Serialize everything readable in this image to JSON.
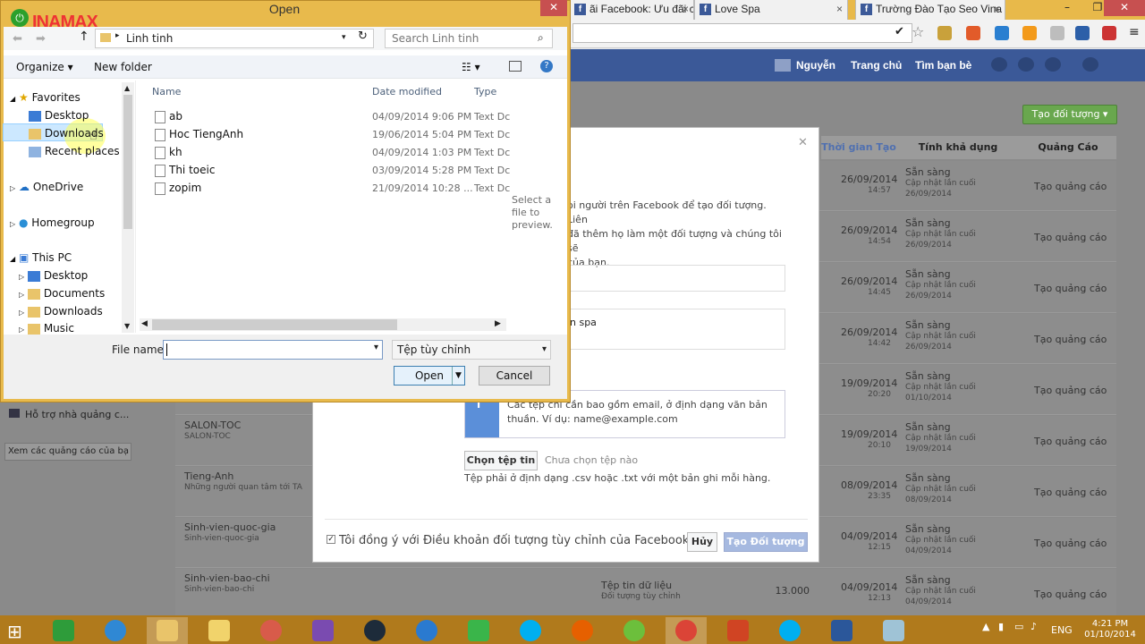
{
  "browser": {
    "tabs": [
      {
        "label": "ãi Facebook: Ưu đãi c",
        "icon": "facebook-icon"
      },
      {
        "label": "Love Spa",
        "icon": "facebook-icon"
      },
      {
        "label": "Trường Đào Tạo Seo Vina",
        "icon": "facebook-icon"
      }
    ]
  },
  "fb": {
    "nav": {
      "user": "Nguyễn",
      "home": "Trang chủ",
      "find_friends": "Tìm bạn bè"
    },
    "create_audience_button": "Tạo đối tượng",
    "table": {
      "headers": [
        "Thời gian Tạo",
        "Tính khả dụng",
        "Quảng Cáo"
      ],
      "rows": [
        {
          "name": "",
          "sub": "",
          "source": "",
          "size": "",
          "date": "26/09/2014",
          "time": "14:57",
          "status": "Sẵn sàng",
          "status_sub": "Cập nhật lần cuối",
          "status_date": "26/09/2014",
          "action": "Tạo quảng cáo"
        },
        {
          "name": "",
          "sub": "",
          "source": "",
          "size": "",
          "date": "26/09/2014",
          "time": "14:54",
          "status": "Sẵn sàng",
          "status_sub": "Cập nhật lần cuối",
          "status_date": "26/09/2014",
          "action": "Tạo quảng cáo"
        },
        {
          "name": "",
          "sub": "",
          "source": "",
          "size": "",
          "date": "26/09/2014",
          "time": "14:45",
          "status": "Sẵn sàng",
          "status_sub": "Cập nhật lần cuối",
          "status_date": "26/09/2014",
          "action": "Tạo quảng cáo"
        },
        {
          "name": "",
          "sub": "",
          "source": "",
          "size": "",
          "date": "26/09/2014",
          "time": "14:42",
          "status": "Sẵn sàng",
          "status_sub": "Cập nhật lần cuối",
          "status_date": "26/09/2014",
          "action": "Tạo quảng cáo"
        },
        {
          "name": "",
          "sub": "",
          "source": "",
          "size": "",
          "date": "19/09/2014",
          "time": "20:20",
          "status": "Sẵn sàng",
          "status_sub": "Cập nhật lần cuối",
          "status_date": "01/10/2014",
          "action": "Tạo quảng cáo"
        },
        {
          "name": "SALON-TOC",
          "sub": "SALON-TOC",
          "source": "",
          "size": "",
          "date": "19/09/2014",
          "time": "20:10",
          "status": "Sẵn sàng",
          "status_sub": "Cập nhật lần cuối",
          "status_date": "19/09/2014",
          "action": "Tạo quảng cáo"
        },
        {
          "name": "Tieng-Anh",
          "sub": "Những người quan tâm tới TA",
          "source": "",
          "size": "",
          "date": "08/09/2014",
          "time": "23:35",
          "status": "Sẵn sàng",
          "status_sub": "Cập nhật lần cuối",
          "status_date": "08/09/2014",
          "action": "Tạo quảng cáo"
        },
        {
          "name": "Sinh-vien-quoc-gia",
          "sub": "Sinh-vien-quoc-gia",
          "source": "",
          "size": "",
          "date": "04/09/2014",
          "time": "12:15",
          "status": "Sẵn sàng",
          "status_sub": "Cập nhật lần cuối",
          "status_date": "04/09/2014",
          "action": "Tạo quảng cáo"
        },
        {
          "name": "Sinh-vien-bao-chi",
          "sub": "Sinh-vien-bao-chi",
          "source": "Tệp tin dữ liệu",
          "source_sub": "Đối tượng tùy chỉnh",
          "size": "13.000",
          "date": "04/09/2014",
          "time": "12:13",
          "status": "Sẵn sàng",
          "status_sub": "Cập nhật lần cuối",
          "status_date": "04/09/2014",
          "action": "Tạo quảng cáo"
        }
      ]
    },
    "left": {
      "support_link": "Hỗ trợ nhà quảng c...",
      "view_ads": "Xem các quảng cáo của bạ"
    },
    "modal": {
      "intro_line1": "ọi người trên Facebook để tạo đối tượng. Liên",
      "intro_line2": "đã thêm họ làm một đối tượng và chúng tôi sẽ",
      "intro_line3": "của bạn.",
      "name_value": "n spa",
      "info_line1": "Các tệp chỉ cần bao gồm email, ở định dạng văn bản",
      "info_line2": "thuần. Ví dụ: name@example.com",
      "choose_file": "Chọn tệp tin",
      "no_file": "Chưa chọn tệp nào",
      "file_hint": "Tệp phải ở định dạng .csv hoặc .txt với một bản ghi mỗi hàng.",
      "agree": "Tôi đồng ý với Điều khoản đối tượng tùy chỉnh của Facebook",
      "cancel": "Hủy",
      "create": "Tạo Đối tượng"
    }
  },
  "dialog": {
    "title": "Open",
    "path": "Linh tinh",
    "search_placeholder": "Search Linh tinh",
    "organize": "Organize",
    "new_folder": "New folder",
    "nav": {
      "favorites": "Favorites",
      "desktop": "Desktop",
      "downloads": "Downloads",
      "recent": "Recent places",
      "onedrive": "OneDrive",
      "homegroup": "Homegroup",
      "thispc": "This PC",
      "pc_desktop": "Desktop",
      "pc_documents": "Documents",
      "pc_downloads": "Downloads",
      "pc_music": "Music"
    },
    "columns": {
      "name": "Name",
      "date": "Date modified",
      "type": "Type"
    },
    "files": [
      {
        "name": "ab",
        "date": "04/09/2014 9:06 PM",
        "type": "Text Dc"
      },
      {
        "name": "Hoc TiengAnh",
        "date": "19/06/2014 5:04 PM",
        "type": "Text Dc"
      },
      {
        "name": "kh",
        "date": "04/09/2014 1:03 PM",
        "type": "Text Dc"
      },
      {
        "name": "Thi toeic",
        "date": "03/09/2014 5:28 PM",
        "type": "Text Dc"
      },
      {
        "name": "zopim",
        "date": "21/09/2014 10:28 ...",
        "type": "Text Dc"
      }
    ],
    "preview": "Select a file to preview.",
    "file_name_label": "File name:",
    "file_name_value": "",
    "filter": "Tệp tùy chỉnh",
    "open": "Open",
    "cancel": "Cancel"
  },
  "watermark": "INAMAX",
  "taskbar": {
    "lang": "ENG",
    "time": "4:21 PM",
    "date": "01/10/2014"
  },
  "colors": {
    "fb_blue": "#3b5998",
    "dialog_frame": "#e8ba4c",
    "taskbar": "#b07a1c"
  }
}
